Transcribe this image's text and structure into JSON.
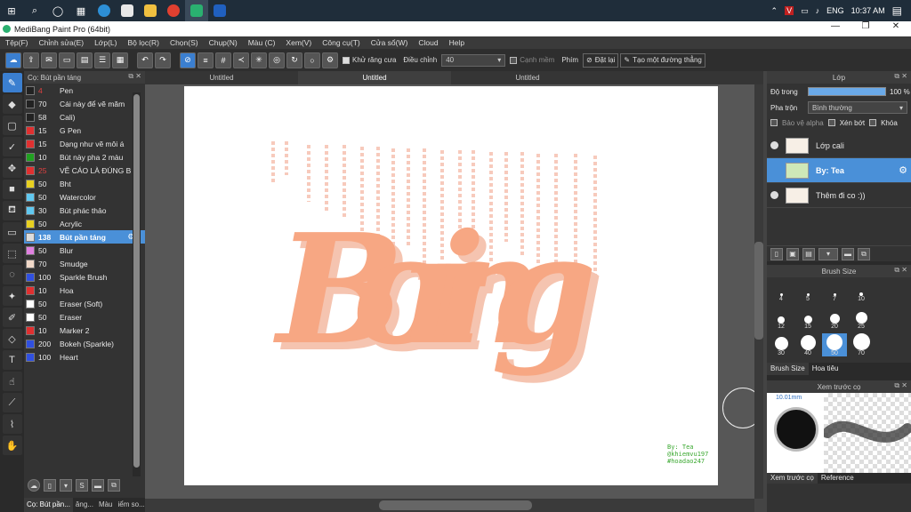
{
  "taskbar": {
    "apps": [
      "windows-start-icon",
      "search-icon",
      "task-view-icon",
      "widgets-icon",
      "edge-icon",
      "store-icon",
      "explorer-icon",
      "chrome-icon",
      "medibang-icon",
      "app-icon"
    ],
    "language": "ENG",
    "time": "10:37 AM"
  },
  "window": {
    "title": "MediBang Paint Pro (64bit)",
    "minimize": "—",
    "maximize": "❐",
    "close": "✕"
  },
  "menu": [
    "Tệp(F)",
    "Chỉnh sửa(E)",
    "Lớp(L)",
    "Bộ lọc(R)",
    "Chọn(S)",
    "Chụp(N)",
    "Màu (C)",
    "Xem(V)",
    "Công cụ(T)",
    "Cửa sổ(W)",
    "Cloud",
    "Help"
  ],
  "toolbar": {
    "antialias_label": "Khử răng cưa",
    "adjust_label": "Điều chỉnh",
    "adjust_value": "40",
    "smooth_label": "Cạnh mềm",
    "key_label": "Phím",
    "reset_label": "Đặt lại",
    "straight_label": "Tạo một đường thẳng"
  },
  "brush_panel": {
    "title": "Cọ: Bút pần táng",
    "brushes": [
      {
        "size": "4",
        "name": "Pen",
        "color": "#222222",
        "size_color": "#e04040"
      },
      {
        "size": "70",
        "name": "Cái này để vẽ măm",
        "color": "#222222"
      },
      {
        "size": "58",
        "name": "Cali)",
        "color": "#222222"
      },
      {
        "size": "15",
        "name": "G Pen",
        "color": "#e03030"
      },
      {
        "size": "15",
        "name": "Dạng như vẽ môi á",
        "color": "#e03030"
      },
      {
        "size": "10",
        "name": "Bút này pha 2 màu",
        "color": "#20a020"
      },
      {
        "size": "25",
        "name": "VẼ CÁO LÀ ĐÚNG B",
        "color": "#e03030",
        "size_color": "#e04040"
      },
      {
        "size": "50",
        "name": "Bht",
        "color": "#e8d020"
      },
      {
        "size": "50",
        "name": "Watercolor",
        "color": "#60c8f0"
      },
      {
        "size": "30",
        "name": "Bút phác thảo",
        "color": "#60c8f0"
      },
      {
        "size": "50",
        "name": "Acrylic",
        "color": "#e8d020"
      },
      {
        "size": "138",
        "name": "Bút pần táng",
        "color": "#dddddd",
        "selected": true
      },
      {
        "size": "50",
        "name": "Blur",
        "color": "#e080e0"
      },
      {
        "size": "70",
        "name": "Smudge",
        "color": "#f0d8c8"
      },
      {
        "size": "100",
        "name": "Sparkle Brush",
        "color": "#3050e0"
      },
      {
        "size": "10",
        "name": "Hoa",
        "color": "#e03030"
      },
      {
        "size": "50",
        "name": "Eraser (Soft)",
        "color": "#ffffff"
      },
      {
        "size": "50",
        "name": "Eraser",
        "color": "#ffffff"
      },
      {
        "size": "10",
        "name": "Marker 2",
        "color": "#e03030"
      },
      {
        "size": "200",
        "name": "Bokeh (Sparkle)",
        "color": "#3050e0"
      },
      {
        "size": "100",
        "name": "Heart",
        "color": "#3050e0"
      }
    ],
    "bottom_tabs": [
      "Cọ: Bút pần...",
      "ăng...",
      "Màu",
      "iểm so..."
    ]
  },
  "doc_tabs": [
    "Untitled",
    "Untitled",
    "Untitled"
  ],
  "canvas": {
    "lettering": "Boring",
    "credit_lines": [
      "By: Tea",
      "@khiemvu197",
      "#hoadao247"
    ]
  },
  "layer_panel": {
    "title": "Lớp",
    "opacity_label": "Độ trong",
    "opacity_value": "100 %",
    "blend_label": "Pha trộn",
    "blend_value": "Bình thường",
    "protect_alpha": "Bảo vệ alpha",
    "clipping": "Xén bớt",
    "lock": "Khóa",
    "layers": [
      {
        "name": "Lớp cali",
        "selected": false
      },
      {
        "name": "By: Tea",
        "selected": true
      },
      {
        "name": "Thêm đi co :))",
        "selected": false
      }
    ]
  },
  "brush_size_panel": {
    "title": "Brush Size",
    "sizes": [
      "4",
      "5",
      "7",
      "10",
      "12",
      "15",
      "20",
      "25",
      "30",
      "40",
      "50",
      "70"
    ],
    "tabs": [
      "Brush Size",
      "Hoa tiêu"
    ]
  },
  "preview_panel": {
    "title": "Xem trước cọ",
    "size_text": "10.01mm",
    "tabs": [
      "Xem trước cọ",
      "Reference"
    ]
  }
}
